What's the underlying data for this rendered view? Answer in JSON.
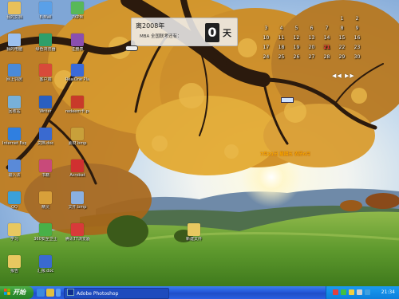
{
  "countdown": {
    "title": "离2008年",
    "subtitle": "MBA 全国联考还有：",
    "days": "0",
    "unit": "天"
  },
  "calendar": {
    "header": "",
    "today": "21",
    "rows": [
      [
        "",
        "",
        "",
        "",
        "",
        "1",
        "2"
      ],
      [
        "3",
        "4",
        "5",
        "6",
        "7",
        "8",
        "9"
      ],
      [
        "10",
        "11",
        "12",
        "13",
        "14",
        "15",
        "16"
      ],
      [
        "17",
        "18",
        "19",
        "20",
        "21",
        "22",
        "23"
      ],
      [
        "24",
        "25",
        "26",
        "27",
        "28",
        "29",
        "30"
      ]
    ],
    "nav": "◀◀ ▶▶"
  },
  "date_text": "7月21日 星期五 农历6月",
  "desktop_icons": [
    {
      "name": "icon-my-documents",
      "label": "我的文档",
      "color": "#e8c05a"
    },
    {
      "name": "icon-ematic",
      "label": "E-Mail",
      "color": "#5aa0e8"
    },
    {
      "name": "icon-pkpm",
      "label": "PKPM",
      "color": "#58b858"
    },
    {
      "name": "icon-my-computer",
      "label": "我的电脑",
      "color": "#9cc0ee"
    },
    {
      "name": "icon-green-browser",
      "label": "绿色浏览器",
      "color": "#2e9f6a"
    },
    {
      "name": "icon-winrar",
      "label": "注册表",
      "color": "#8a4fb0"
    },
    {
      "name": "icon-network",
      "label": "网上邻居",
      "color": "#4a8ad8"
    },
    {
      "name": "icon-client",
      "label": "客户端",
      "color": "#d84a3a"
    },
    {
      "name": "icon-realplayer",
      "label": "RealOne Player",
      "color": "#3a6ad8"
    },
    {
      "name": "icon-recycle",
      "label": "回收站",
      "color": "#78b0d8"
    },
    {
      "name": "icon-ms-word",
      "label": "Writer",
      "color": "#2a5fc0"
    },
    {
      "name": "icon-pdf",
      "label": "redeem卡.pdf",
      "color": "#c83a2a"
    },
    {
      "name": "icon-ie",
      "label": "Internet Explorer",
      "color": "#2f7fe0"
    },
    {
      "name": "icon-word-doc",
      "label": "文档.doc",
      "color": "#3a6ad0"
    },
    {
      "name": "icon-image",
      "label": "素材.bmp",
      "color": "#c8a03a"
    },
    {
      "name": "icon-ime",
      "label": "输入法",
      "color": "#5a8ad8"
    },
    {
      "name": "icon-books",
      "label": "书籍",
      "color": "#c84a7a"
    },
    {
      "name": "icon-acrobat",
      "label": "Acrobat",
      "color": "#d03030"
    },
    {
      "name": "icon-qq",
      "label": "QQ",
      "color": "#3aa0d8"
    },
    {
      "name": "icon-tool",
      "label": "精灵",
      "color": "#d8a03a"
    },
    {
      "name": "icon-file",
      "label": "文件.bmp",
      "color": "#8ab0e0"
    },
    {
      "name": "icon-folder-study",
      "label": "学习",
      "color": "#e8c860"
    },
    {
      "name": "icon-360",
      "label": "360安全卫士",
      "color": "#48b048"
    },
    {
      "name": "icon-tencent",
      "label": "腾讯TT浏览器",
      "color": "#d83a3a"
    },
    {
      "name": "icon-folder-report",
      "label": "报告",
      "color": "#e8c860"
    },
    {
      "name": "icon-doc",
      "label": "汇报.doc",
      "color": "#3a6ad0"
    },
    {
      "name": "icon-folder-desk",
      "label": "新建文件",
      "color": "#e8c860"
    }
  ],
  "taskbar": {
    "start_label": "开始",
    "window_title": "Adobe Photoshop",
    "clock": "21:34"
  }
}
